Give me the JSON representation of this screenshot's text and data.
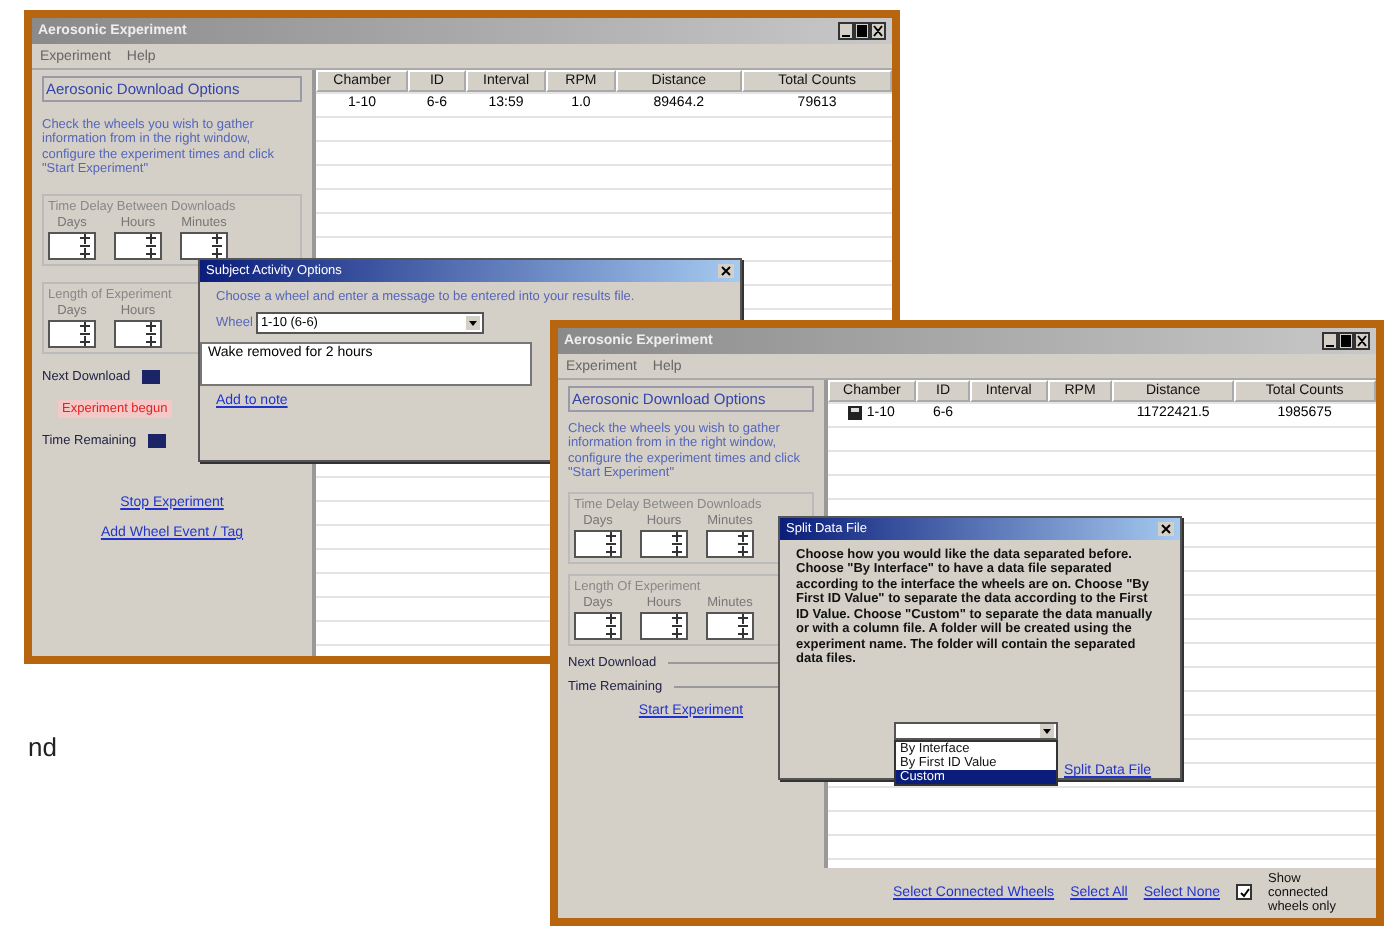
{
  "page_text": "nd",
  "windows": [
    {
      "title": "Aerosonic Experiment",
      "menu": [
        "Experiment",
        "Help"
      ],
      "panel": {
        "heading": "Aerosonic Download Options",
        "description": "Check the wheels you wish to gather information from in the right window, configure the experiment times and click \"Start Experiment\"",
        "groups": [
          {
            "label": "Time Delay Between Downloads",
            "units": [
              "Days",
              "Hours",
              "Minutes"
            ]
          },
          {
            "label": "Length of Experiment",
            "units": [
              "Days",
              "Hours"
            ]
          }
        ],
        "status": [
          {
            "kind": "indicator",
            "label": "Next Download"
          },
          {
            "kind": "alert",
            "label": "Experiment begun"
          },
          {
            "kind": "indicator",
            "label": "Time Remaining"
          }
        ],
        "links": [
          "Stop Experiment",
          "Add Wheel Event / Tag"
        ]
      },
      "table": {
        "columns": [
          "Chamber",
          "ID",
          "Interval",
          "RPM",
          "Distance",
          "Total Counts"
        ],
        "rows": [
          {
            "icon": false,
            "cells": [
              "1-10",
              "6-6",
              "13:59",
              "1.0",
              "89464.2",
              "79613"
            ]
          }
        ]
      },
      "dialog": {
        "title": "Subject Activity Options",
        "message": "Choose a wheel and enter a message to be entered into your results file.",
        "select_label": "Wheel",
        "select_value": "1-10 (6-6)",
        "note": "Wake removed for 2 hours",
        "link": "Add to note"
      }
    },
    {
      "title": "Aerosonic Experiment",
      "menu": [
        "Experiment",
        "Help"
      ],
      "panel": {
        "heading": "Aerosonic Download Options",
        "description": "Check the wheels you wish to gather information from in the right window, configure the experiment times and click \"Start Experiment\"",
        "groups": [
          {
            "label": "Time Delay Between Downloads",
            "units": [
              "Days",
              "Hours",
              "Minutes"
            ]
          },
          {
            "label": "Length Of Experiment",
            "units": [
              "Days",
              "Hours",
              "Minutes"
            ]
          }
        ],
        "status": [
          {
            "kind": "line",
            "label": "Next Download"
          },
          {
            "kind": "line",
            "label": "Time Remaining"
          }
        ],
        "links": [
          "Start Experiment"
        ]
      },
      "table": {
        "columns": [
          "Chamber",
          "ID",
          "Interval",
          "RPM",
          "Distance",
          "Total Counts"
        ],
        "rows": [
          {
            "icon": true,
            "cells": [
              "1-10",
              "6-6",
              "",
              "",
              "11722421.5",
              "1985675"
            ]
          }
        ]
      },
      "dialog": {
        "title": "Split Data File",
        "message": "Choose how you would like the data separated before. Choose \"By Interface\" to have a data file separated according to the interface the wheels are on. Choose \"By First ID Value\" to separate the data according to the First ID Value. Choose \"Custom\" to separate the data manually or with a column file. A folder will be created using the experiment name. The folder will contain the separated data files.",
        "options": [
          {
            "label": "By Interface",
            "selected": false
          },
          {
            "label": "By First ID Value",
            "selected": false
          },
          {
            "label": "Custom",
            "selected": true
          }
        ],
        "link": "Split Data File"
      },
      "footer": {
        "links": [
          "Select Connected Wheels",
          "Select All",
          "Select None"
        ],
        "checkbox": {
          "label": "Show connected wheels only",
          "checked": true
        }
      }
    }
  ]
}
